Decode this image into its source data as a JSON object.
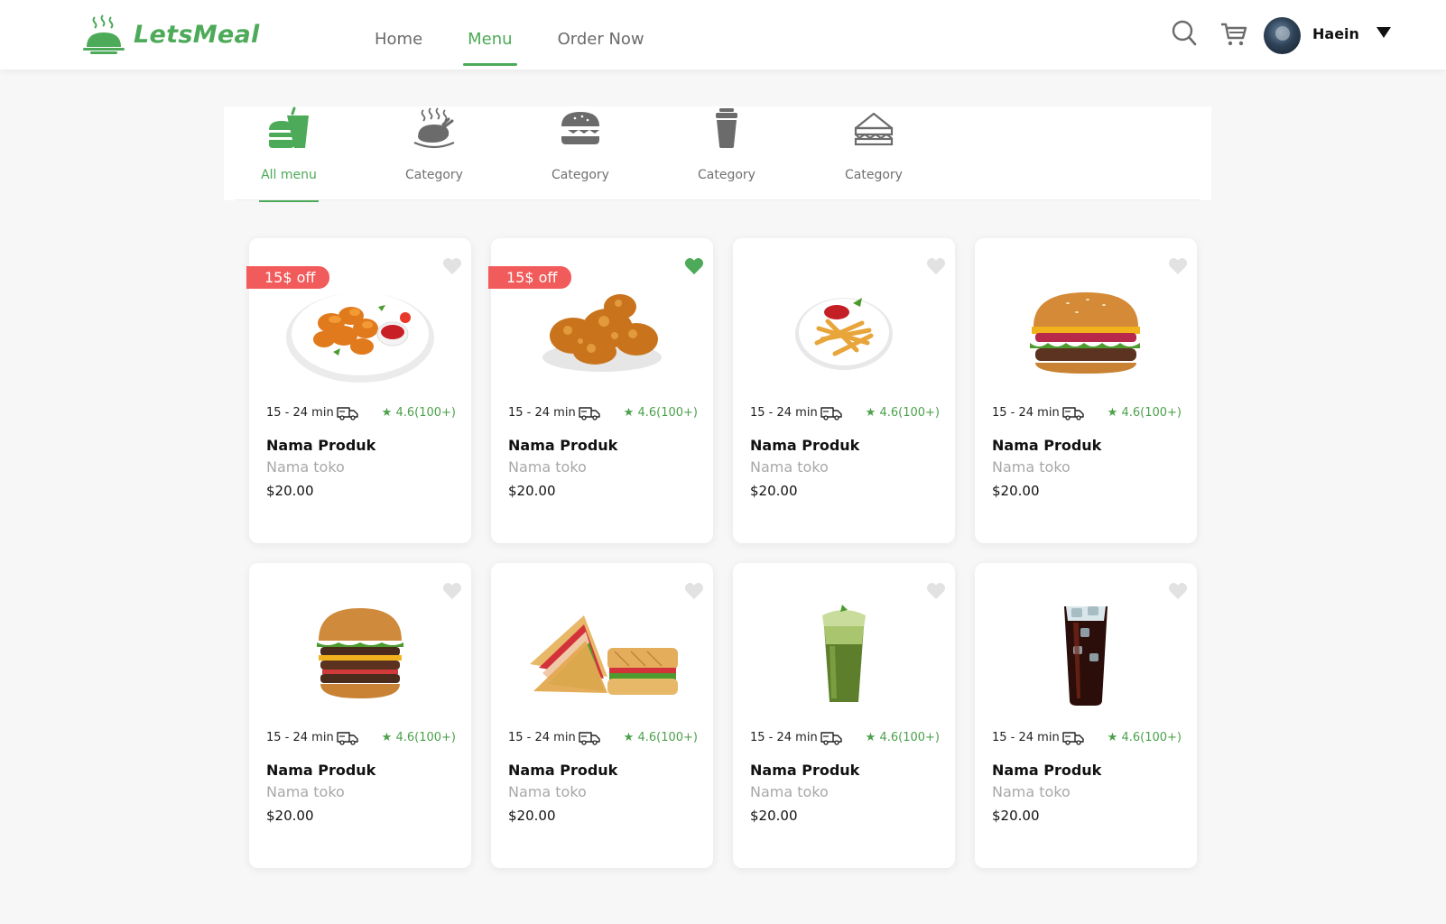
{
  "brand": {
    "name": "LetsMeal",
    "accent": "#4caa58"
  },
  "nav": {
    "items": [
      {
        "label": "Home",
        "active": false
      },
      {
        "label": "Menu",
        "active": true
      },
      {
        "label": "Order Now",
        "active": false
      }
    ]
  },
  "header": {
    "icons": [
      "search-icon",
      "cart-icon",
      "chevron-down-icon"
    ],
    "user": {
      "name": "Haein"
    }
  },
  "categories": [
    {
      "label": "All menu",
      "icon": "fastfood-icon",
      "active": true
    },
    {
      "label": "Category",
      "icon": "roast-chicken-icon",
      "active": false
    },
    {
      "label": "Category",
      "icon": "burger-icon",
      "active": false
    },
    {
      "label": "Category",
      "icon": "drink-cup-icon",
      "active": false
    },
    {
      "label": "Category",
      "icon": "sandwich-icon",
      "active": false
    }
  ],
  "products": [
    {
      "badge": "15$ off",
      "favorite": false,
      "image": "chicken-nuggets",
      "eta": "15 - 24 min",
      "rating": "4.6(100+)",
      "name": "Nama Produk",
      "store": "Nama toko",
      "price": "$20.00"
    },
    {
      "badge": "15$ off",
      "favorite": true,
      "image": "fried-chicken",
      "eta": "15 - 24 min",
      "rating": "4.6(100+)",
      "name": "Nama Produk",
      "store": "Nama toko",
      "price": "$20.00"
    },
    {
      "badge": "",
      "favorite": false,
      "image": "french-fries",
      "eta": "15 - 24 min",
      "rating": "4.6(100+)",
      "name": "Nama Produk",
      "store": "Nama toko",
      "price": "$20.00"
    },
    {
      "badge": "",
      "favorite": false,
      "image": "burger",
      "eta": "15 - 24 min",
      "rating": "4.6(100+)",
      "name": "Nama Produk",
      "store": "Nama toko",
      "price": "$20.00"
    },
    {
      "badge": "",
      "favorite": false,
      "image": "double-burger",
      "eta": "15 - 24 min",
      "rating": "4.6(100+)",
      "name": "Nama Produk",
      "store": "Nama toko",
      "price": "$20.00"
    },
    {
      "badge": "",
      "favorite": false,
      "image": "sandwich",
      "eta": "15 - 24 min",
      "rating": "4.6(100+)",
      "name": "Nama Produk",
      "store": "Nama toko",
      "price": "$20.00"
    },
    {
      "badge": "",
      "favorite": false,
      "image": "matcha-drink",
      "eta": "15 - 24 min",
      "rating": "4.6(100+)",
      "name": "Nama Produk",
      "store": "Nama toko",
      "price": "$20.00"
    },
    {
      "badge": "",
      "favorite": false,
      "image": "cola-glass",
      "eta": "15 - 24 min",
      "rating": "4.6(100+)",
      "name": "Nama Produk",
      "store": "Nama toko",
      "price": "$20.00"
    }
  ],
  "colors": {
    "accent": "#4caa58",
    "badge": "#f15b5b",
    "rating": "#4ba14a",
    "muted": "#a8a8a8",
    "heart_off": "#e2e2e2"
  }
}
